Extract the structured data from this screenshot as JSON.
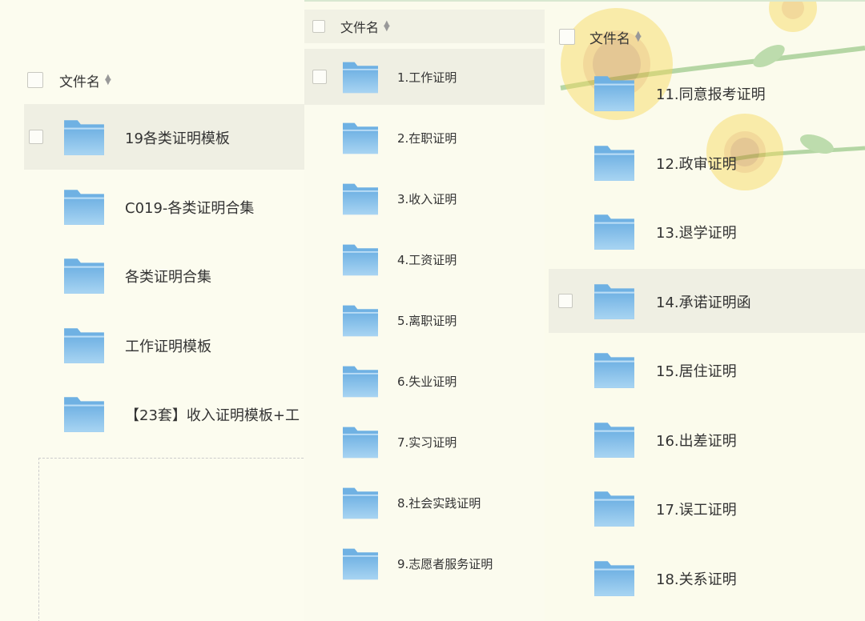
{
  "header_label": "文件名",
  "left_panel": {
    "items": [
      {
        "name": "19各类证明模板"
      },
      {
        "name": "C019-各类证明合集"
      },
      {
        "name": "各类证明合集"
      },
      {
        "name": "工作证明模板"
      },
      {
        "name": "【23套】收入证明模板+工"
      }
    ]
  },
  "mid_panel": {
    "items": [
      {
        "name": "1.工作证明"
      },
      {
        "name": "2.在职证明"
      },
      {
        "name": "3.收入证明"
      },
      {
        "name": "4.工资证明"
      },
      {
        "name": "5.离职证明"
      },
      {
        "name": "6.失业证明"
      },
      {
        "name": "7.实习证明"
      },
      {
        "name": "8.社会实践证明"
      },
      {
        "name": "9.志愿者服务证明"
      }
    ]
  },
  "right_panel": {
    "items": [
      {
        "name": "11.同意报考证明"
      },
      {
        "name": "12.政审证明"
      },
      {
        "name": "13.退学证明"
      },
      {
        "name": "14.承诺证明函"
      },
      {
        "name": "15.居住证明"
      },
      {
        "name": "16.出差证明"
      },
      {
        "name": "17.误工证明"
      },
      {
        "name": "18.关系证明"
      }
    ]
  },
  "colors": {
    "background": "#fbfbec",
    "selected_row": "#efefe3",
    "folder_light": "#a8d4f2",
    "folder_dark": "#6fb1e3"
  }
}
